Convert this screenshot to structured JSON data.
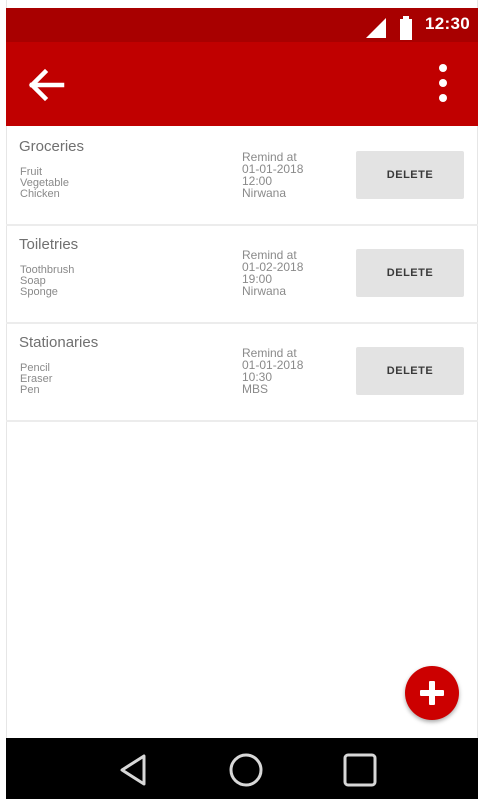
{
  "status_bar": {
    "time": "12:30"
  },
  "app_bar": {
    "back_icon": "arrow-left-icon",
    "menu_icon": "more-vert-icon",
    "color": "#c00000"
  },
  "list": [
    {
      "title": "Groceries",
      "items": [
        "Fruit",
        "Vegetable",
        "Chicken"
      ],
      "remind_label": "Remind at",
      "date": "01-01-2018",
      "time": "12:00",
      "location": "Nirwana",
      "delete_label": "DELETE"
    },
    {
      "title": "Toiletries",
      "items": [
        "Toothbrush",
        "Soap",
        "Sponge"
      ],
      "remind_label": "Remind at",
      "date": "01-02-2018",
      "time": "19:00",
      "location": "Nirwana",
      "delete_label": "DELETE"
    },
    {
      "title": "Stationaries",
      "items": [
        "Pencil",
        "Eraser",
        "Pen"
      ],
      "remind_label": "Remind at",
      "date": "01-01-2018",
      "time": "10:30",
      "location": "MBS",
      "delete_label": "DELETE"
    }
  ],
  "fab": {
    "icon": "plus-icon",
    "color": "#cc0000"
  },
  "nav_bar": {
    "icons": [
      "nav-back-icon",
      "nav-home-icon",
      "nav-recents-icon"
    ]
  }
}
